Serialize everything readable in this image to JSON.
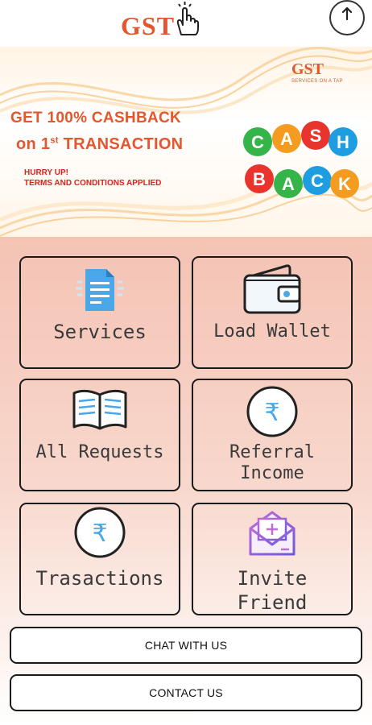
{
  "header": {
    "logo_text": "GST",
    "power_icon": "power-icon"
  },
  "banner": {
    "brand_text": "GST",
    "brand_tagline": "SERVICES ON A TAP",
    "promo_line1": "GET 100% CASHBACK",
    "promo_line2_prefix": "on 1",
    "promo_line2_sup": "st",
    "promo_line2_suffix": " TRANSACTION",
    "hurry": "HURRY UP!",
    "terms": "TERMS AND CONDITIONS APPLIED",
    "cashback_letters_row1": [
      "C",
      "A",
      "S",
      "H"
    ],
    "cashback_letters_row2": [
      "B",
      "A",
      "C",
      "K"
    ]
  },
  "tiles": {
    "services": {
      "label": "Services",
      "icon": "document-icon"
    },
    "load_wallet": {
      "label": "Load Wallet",
      "icon": "wallet-icon"
    },
    "all_requests": {
      "label": "All Requests",
      "icon": "open-book-icon"
    },
    "referral_income": {
      "label_line1": "Referral",
      "label_line2": "Income",
      "icon": "rupee-icon"
    },
    "transactions": {
      "label": "Trasactions",
      "icon": "rupee-icon"
    },
    "invite_friend": {
      "label_line1": "Invite",
      "label_line2": "Friend",
      "icon": "mail-add-icon"
    }
  },
  "buttons": {
    "chat": "CHAT WITH US",
    "contact": "CONTACT US"
  },
  "colors": {
    "brand": "#e4572e",
    "grid_top": "#f4c3b4",
    "doc_blue": "#4aa8e8",
    "invite_purple": "#9b5bd6"
  }
}
